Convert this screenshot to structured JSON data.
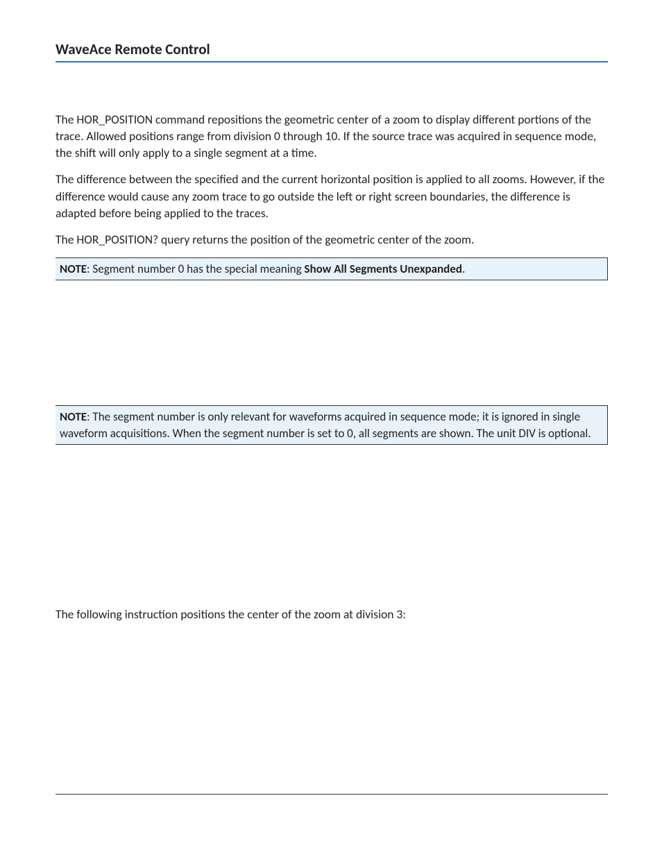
{
  "header": {
    "title": "WaveAce Remote Control"
  },
  "body": {
    "p1": "The HOR_POSITION command repositions the geometric center of a zoom to display different portions of the trace. Allowed positions range from division 0 through 10. If the source trace was acquired in sequence mode, the shift will only apply to a single segment at a time.",
    "p2": "The difference between the specified and the current horizontal position is applied to all zooms. However, if the difference would cause any zoom trace to go outside the left or right screen boundaries, the difference is adapted before being applied to the traces.",
    "p3": "The HOR_POSITION? query returns the position of the geometric center of the zoom.",
    "note1": {
      "label": "NOTE",
      "text_before": ": Segment number 0 has the special meaning ",
      "strong": "Show All Segments Unexpanded",
      "text_after": "."
    },
    "note2": {
      "label": "NOTE",
      "text": ": The segment number is only relevant for waveforms acquired in sequence mode; it is ignored in single waveform acquisitions. When the segment number is set to 0, all segments are shown. The unit DIV is optional."
    },
    "p4": "The following instruction positions the center of the zoom at division 3:"
  }
}
